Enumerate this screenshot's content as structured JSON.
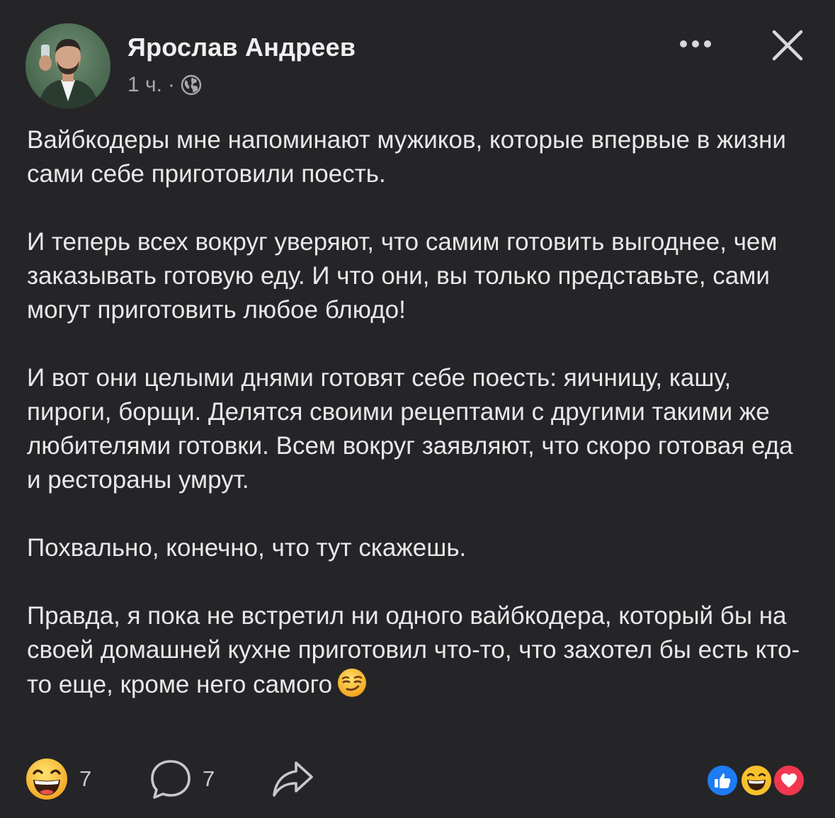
{
  "post": {
    "author_name": "Ярослав Андреев",
    "timestamp": "1 ч.",
    "separator": "·",
    "privacy_icon": "globe-icon",
    "more_icon": "ellipsis-icon",
    "close_icon": "close-icon",
    "paragraphs": [
      "Вайбкодеры мне напоминают мужиков, которые впервые в жизни сами себе приготовили поесть.",
      "И теперь всех вокруг уверяют, что самим готовить выгоднее, чем заказывать готовую еду. И что они, вы только представьте, сами могут приготовить любое блюдо!",
      "И вот они целыми днями готовят себе поесть: яичницу, кашу, пироги, борщи. Делятся своими рецептами с другими такими же любителями готовки. Всем вокруг заявляют, что скоро готовая еда и рестораны умрут.",
      "Похвально, конечно, что тут скажешь.",
      "Правда, я пока не встретил ни одного вайбкодера, который бы на своей домашней кухне приготовил что-то, что захотел бы есть кто-то еще, кроме него самого"
    ],
    "trailing_emoji": "smirk-emoji"
  },
  "actions": {
    "reaction_icon": "laughing-emoji-icon",
    "reaction_count": "7",
    "comment_icon": "comment-bubble-icon",
    "comment_count": "7",
    "share_icon": "share-arrow-icon"
  },
  "reaction_summary": [
    "like-icon",
    "haha-icon",
    "love-icon"
  ],
  "colors": {
    "background": "#252527",
    "text": "#e8e8ea",
    "secondary_text": "#a8a8ad",
    "like_blue": "#1d7cf2",
    "haha_yellow": "#f7c12b",
    "love_red": "#f1374f"
  }
}
